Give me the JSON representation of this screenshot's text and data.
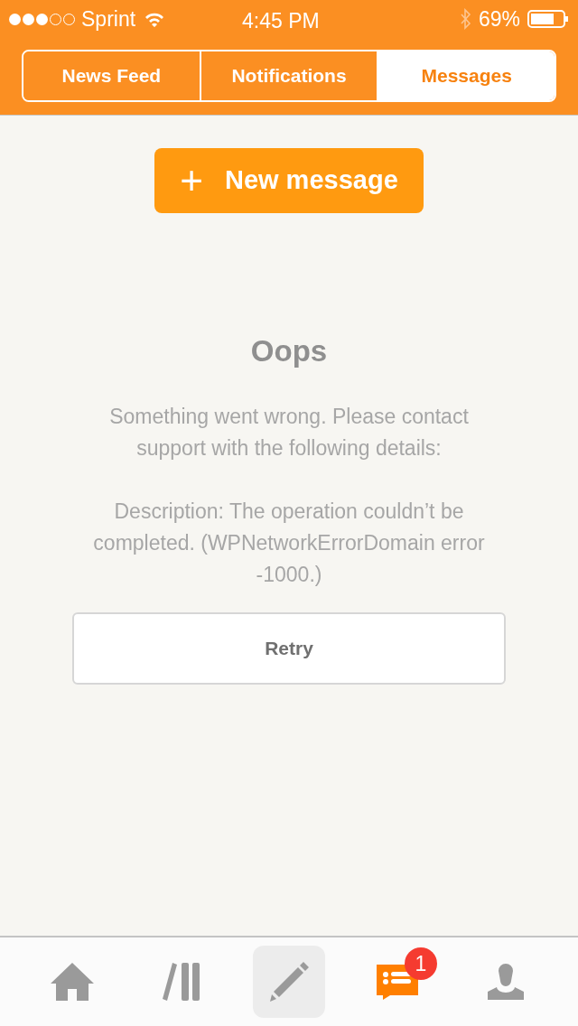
{
  "status_bar": {
    "carrier": "Sprint",
    "time": "4:45 PM",
    "battery": "69%",
    "signal_dots": [
      {
        "on": true
      },
      {
        "on": true
      },
      {
        "on": true
      },
      {
        "on": false
      },
      {
        "on": false
      }
    ]
  },
  "tabs": [
    {
      "label": "News Feed",
      "selected": false
    },
    {
      "label": "Notifications",
      "selected": false
    },
    {
      "label": "Messages",
      "selected": true
    }
  ],
  "new_message_button": {
    "icon": "+",
    "label": "New message"
  },
  "error": {
    "title": "Oops",
    "message": "Something went wrong. Please contact support with the following details:",
    "details": "Description: The operation couldn’t be completed. (WPNetworkErrorDomain error -1000.)",
    "retry": "Retry"
  },
  "tab_bar": [
    {
      "kind": "home",
      "selected": false
    },
    {
      "kind": "reader",
      "selected": false
    },
    {
      "kind": "write",
      "selected": true
    },
    {
      "kind": "notifications",
      "selected": false,
      "badge": "1"
    },
    {
      "kind": "me",
      "selected": false
    }
  ]
}
